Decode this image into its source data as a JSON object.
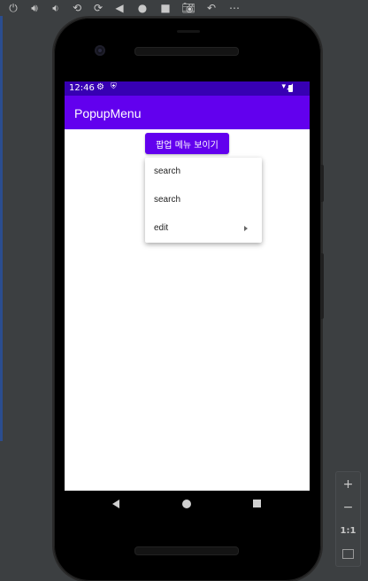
{
  "emulator": {
    "toolbar_icons": [
      "power-icon",
      "volume-up-icon",
      "volume-down-icon",
      "rotate-left-icon",
      "rotate-right-icon",
      "back-icon",
      "home-icon",
      "overview-icon",
      "camera-icon",
      "undo-icon",
      "more-icon"
    ],
    "zoom": {
      "zoom_in": "+",
      "zoom_out": "−",
      "actual_size": "1:1"
    }
  },
  "status_bar": {
    "time": "12:46"
  },
  "app_bar": {
    "title": "PopupMenu"
  },
  "main": {
    "show_popup_label": "팝업 메뉴 보이기"
  },
  "popup_menu": {
    "items": [
      {
        "label": "search"
      },
      {
        "label": "search"
      },
      {
        "label": "edit",
        "has_submenu": true
      }
    ]
  },
  "colors": {
    "primary": "#6200ee",
    "primary_dark": "#3700b3"
  }
}
